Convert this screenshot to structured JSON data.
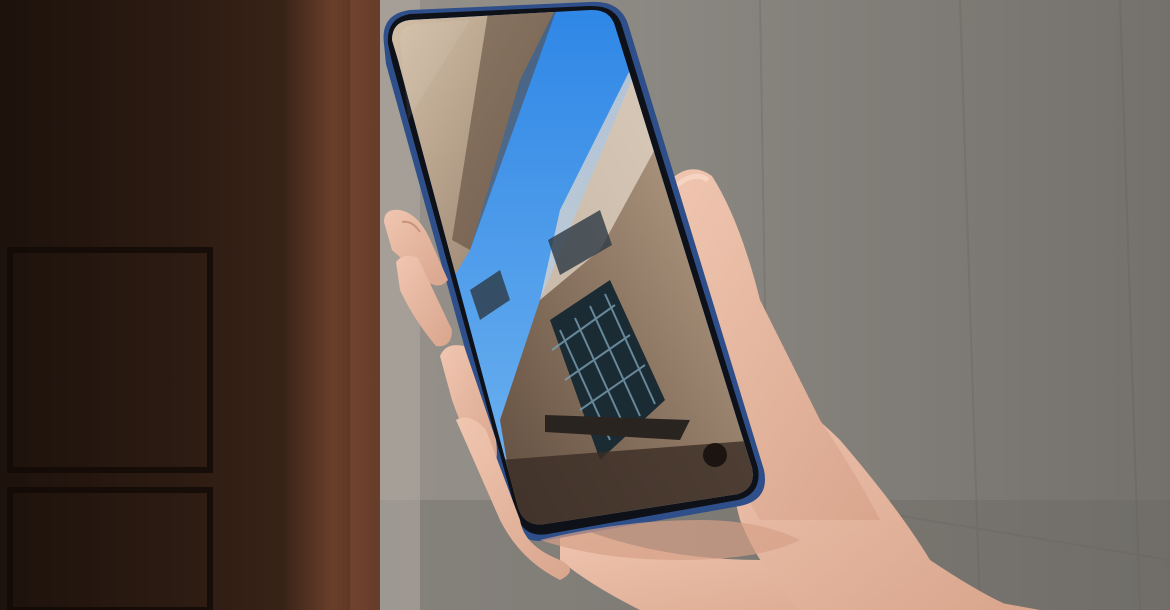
{
  "scene": {
    "subject": "smartphone-held-in-hand",
    "colors": {
      "wall": "#8e8a84",
      "wall_dark": "#6f6b66",
      "door_dark": "#2a1a12",
      "door_frame": "#5a3524",
      "phone_frame": "#3f5f9c",
      "sky": "#3f8fe0",
      "building": "#b79f85",
      "skin": "#e7b8a0",
      "skin_shadow": "#c9937c"
    }
  }
}
